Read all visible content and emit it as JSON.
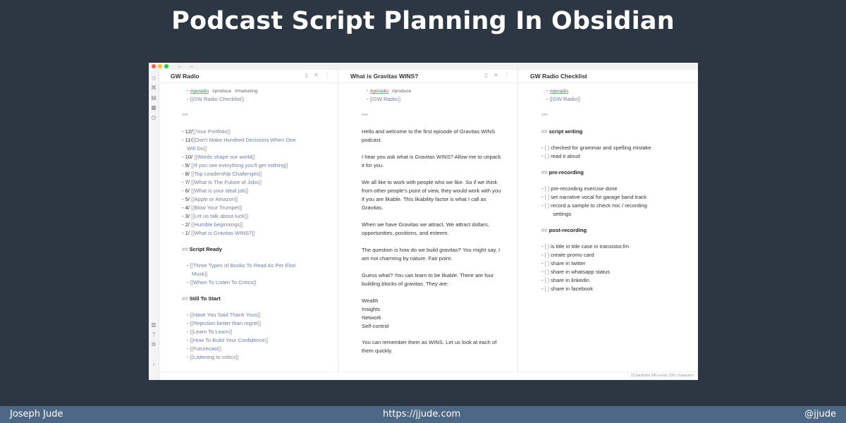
{
  "banner": {
    "title": "Podcast Script Planning In Obsidian"
  },
  "window": {
    "nav_back": "←",
    "nav_forward": "→",
    "ribbon_icons": [
      "graph-icon",
      "command-icon",
      "file-icon",
      "calendar-icon",
      "history-icon",
      "vault-icon",
      "help-icon",
      "settings-icon",
      "collapse-icon"
    ],
    "pane_action_icons": "▯ ✕ ⋮",
    "statusbar": "22 backlinks   345 words   1961 characters"
  },
  "pane1": {
    "title": "GW Radio",
    "tags": [
      "#gwradio",
      "#produce",
      "#marketing"
    ],
    "checklist_link": "GW Radio Checklist",
    "hr": "***",
    "episodes": [
      {
        "num": "12/",
        "title": "Your Portfolio"
      },
      {
        "num": "11/",
        "title": "Don't Make Hundred Decisions When One"
      },
      {
        "num": "",
        "title": "Will Do"
      },
      {
        "num": "10/",
        "title": "Words shape our world"
      },
      {
        "num": "9/",
        "title": "If you see everything you'll get nothing"
      },
      {
        "num": "8/",
        "title": "Top Leadership Challenges"
      },
      {
        "num": "7/",
        "title": "What Is The Future of Jobs"
      },
      {
        "num": "6/",
        "title": "What is your ideal job"
      },
      {
        "num": "5/",
        "title": "Apple or Amazon"
      },
      {
        "num": "4/",
        "title": "Blow Your Trumpet"
      },
      {
        "num": "3/",
        "title": "Let us talk about luck"
      },
      {
        "num": "2/",
        "title": "Humble beginnings"
      },
      {
        "num": "1/",
        "title": "What is Gravitas WINS?"
      }
    ],
    "section_ready": "Script Ready",
    "ready_items": [
      "Three Types of Books To Read As Per Elon",
      "Musk",
      "When To Listen To Critics"
    ],
    "section_start": "Still To Start",
    "start_items": [
      "Have You Said Thank Yous",
      "Rejection better than regret",
      "Learn To Learn",
      "How To Build Your Confidence",
      "Futurecast",
      "Listening to critics"
    ]
  },
  "pane2": {
    "title": "What is Gravitas WINS?",
    "tags": [
      "#gwradio",
      "#produce"
    ],
    "link": "GW Radio",
    "hr": "***",
    "paragraphs": [
      "Hello and welcome to the first episode of Gravitas WINS podcast.",
      "I hear you ask what is Gravitas WINS? Allow me to unpack it for you.",
      "We all like to work with people who we like. So if we think from other people's point of view, they would work with you if you are likable. This likability factor is what I call as Gravitas.",
      "When we have Gravitas we attract. We attract dollars, opportunities, positions, and esteem.",
      "The question is how do we build gravitas? You might say, I am not charming by nature. Fair point.",
      "Guess what? You can learn to be likable. There are four building blocks of gravitas. They are:"
    ],
    "blocks": [
      "Wealth",
      "Insights",
      "Network",
      "Self-control"
    ],
    "closing": "You can remember them as WINS. Let us look at each of them quickly."
  },
  "pane3": {
    "title": "GW Radio Checklist",
    "tags": [
      "#gwradio"
    ],
    "link": "GW Radio",
    "hr": "***",
    "sections": [
      {
        "heading": "script writing",
        "items": [
          "checked for grammar and spelling mistake",
          "read it aloud"
        ]
      },
      {
        "heading": "pre-recording",
        "items": [
          "pre-recording exercise done",
          "set narrative vocal for garage band track",
          "record a sample to check mic / recording",
          "settings"
        ]
      },
      {
        "heading": "post-recording",
        "items": [
          "is title in title case in transistor.fm",
          "create promo card",
          "share in twitter",
          "share in whatsapp status",
          "share in linkedin",
          "share in facebook"
        ]
      }
    ]
  },
  "footer": {
    "author": "Joseph Jude",
    "url": "https://jjude.com",
    "handle": "@jjude"
  }
}
